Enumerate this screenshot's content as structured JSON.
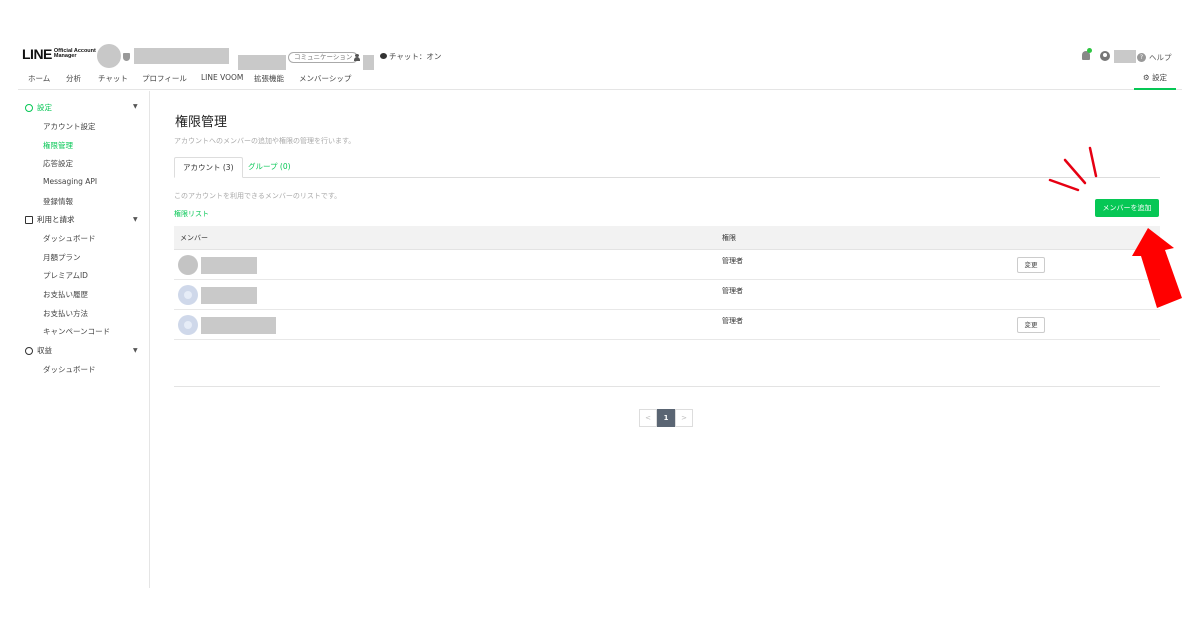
{
  "header": {
    "logo_main": "LINE",
    "logo_sub": "Official Account Manager",
    "account_tag": "コミュニケーション",
    "chat_status": "チャット：オン",
    "help_label": "ヘルプ"
  },
  "nav": {
    "items": [
      "ホーム",
      "分析",
      "チャット",
      "プロフィール",
      "LINE VOOM",
      "拡張機能",
      "メンバーシップ"
    ],
    "settings_label": "設定"
  },
  "sidebar": {
    "groups": [
      {
        "label": "設定",
        "items": [
          "アカウント設定",
          "権限管理",
          "応答設定",
          "Messaging API",
          "登録情報"
        ]
      },
      {
        "label": "利用と請求",
        "items": [
          "ダッシュボード",
          "月額プラン",
          "プレミアムID",
          "お支払い履歴",
          "お支払い方法",
          "キャンペーンコード"
        ]
      },
      {
        "label": "収益",
        "items": [
          "ダッシュボード"
        ]
      }
    ]
  },
  "main": {
    "title": "権限管理",
    "description": "アカウントへのメンバーの追加や権限の管理を行います。",
    "tabs": [
      {
        "label": "アカウント (3)"
      },
      {
        "label": "グループ (0)"
      }
    ],
    "list_description": "このアカウントを利用できるメンバーのリストです。",
    "list_link": "権限リスト",
    "add_button": "メンバーを追加",
    "table": {
      "headers": [
        "メンバー",
        "権限"
      ],
      "rows": [
        {
          "role": "管理者",
          "action": "変更"
        },
        {
          "role": "管理者",
          "action": ""
        },
        {
          "role": "管理者",
          "action": "変更"
        }
      ]
    },
    "pagination": {
      "prev": "<",
      "current": "1",
      "next": ">"
    }
  },
  "colors": {
    "accent": "#06c755",
    "annotation": "#e60012"
  }
}
